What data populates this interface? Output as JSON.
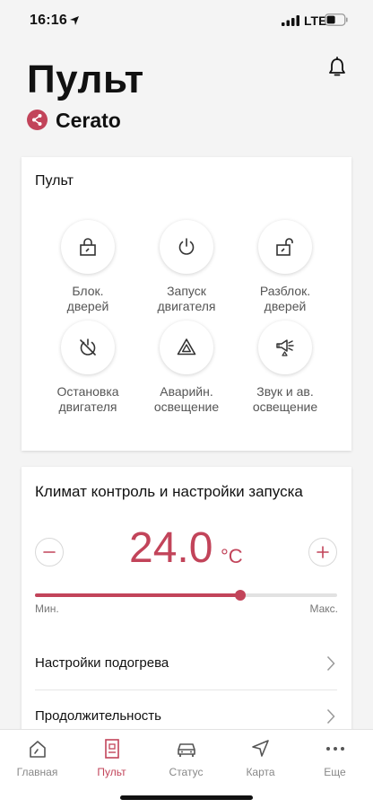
{
  "status_bar": {
    "time": "16:16",
    "network": "LTE",
    "icons": [
      "location-arrow-icon",
      "signal-icon",
      "battery-icon"
    ]
  },
  "header": {
    "title": "Пульт",
    "vehicle": "Cerato",
    "icons": [
      "bell-icon",
      "share-icon"
    ]
  },
  "remote": {
    "title": "Пульт",
    "controls": [
      {
        "label": "Блок.\nдверей",
        "icon": "lock-icon"
      },
      {
        "label": "Запуск\nдвигателя",
        "icon": "power-icon"
      },
      {
        "label": "Разблок.\nдверей",
        "icon": "unlock-icon"
      },
      {
        "label": "Остановка\nдвигателя",
        "icon": "engine-off-icon"
      },
      {
        "label": "Аварийн.\nосвещение",
        "icon": "hazard-icon"
      },
      {
        "label": "Звук и ав.\nосвещение",
        "icon": "horn-lights-icon"
      }
    ]
  },
  "climate": {
    "title": "Климат контроль и настройки запуска",
    "temperature": "24.0",
    "unit": "°C",
    "level_fraction": 0.68,
    "min_label": "Мин.",
    "max_label": "Макс.",
    "rows": [
      {
        "label": "Настройки подогрева"
      },
      {
        "label": "Продолжительность"
      }
    ]
  },
  "tabs": [
    {
      "label": "Главная",
      "icon": "home-icon",
      "active": false
    },
    {
      "label": "Пульт",
      "icon": "remote-icon",
      "active": true
    },
    {
      "label": "Статус",
      "icon": "car-icon",
      "active": false
    },
    {
      "label": "Карта",
      "icon": "navigation-icon",
      "active": false
    },
    {
      "label": "Еще",
      "icon": "more-icon",
      "active": false
    }
  ],
  "colors": {
    "accent": "#c2445a",
    "background": "#f4f4f4",
    "card": "#ffffff"
  }
}
